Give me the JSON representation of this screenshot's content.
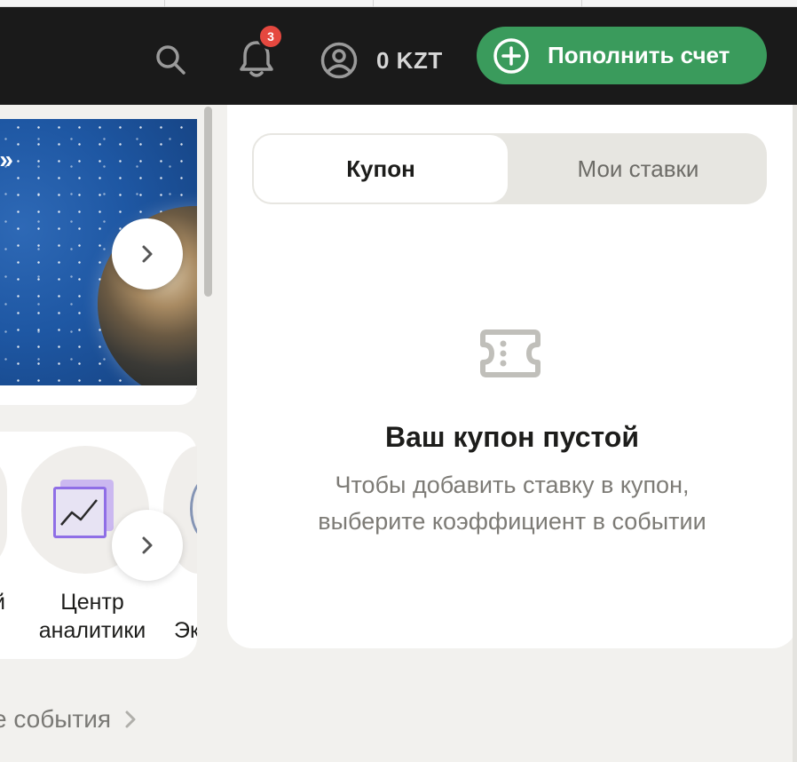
{
  "header": {
    "notifications_count": "3",
    "balance": "0 KZT",
    "topup_label": "Пополнить счет"
  },
  "banner": {
    "headline_fragment": "!»"
  },
  "shortcuts": {
    "left_cut_label_1": "й",
    "left_cut_label_2": "",
    "analytics_label": "Центр аналитики",
    "right_cut_label": "Эк"
  },
  "section_link": "е события",
  "coupon": {
    "tabs": [
      "Купон",
      "Мои ставки"
    ],
    "empty_title": "Ваш купон пустой",
    "empty_text_1": "Чтобы добавить ставку в купон,",
    "empty_text_2": "выберите коэффициент в событии"
  },
  "colors": {
    "header_bg": "#1a1a1a",
    "accent_green": "#3a9b5c",
    "badge_red": "#e5483f",
    "page_bg": "#f2f1ee"
  },
  "icons": [
    "search-icon",
    "bell-icon",
    "user-circle-icon",
    "plus-circle-icon",
    "chevron-right-icon",
    "ticket-icon",
    "analytics-chart-icon"
  ]
}
